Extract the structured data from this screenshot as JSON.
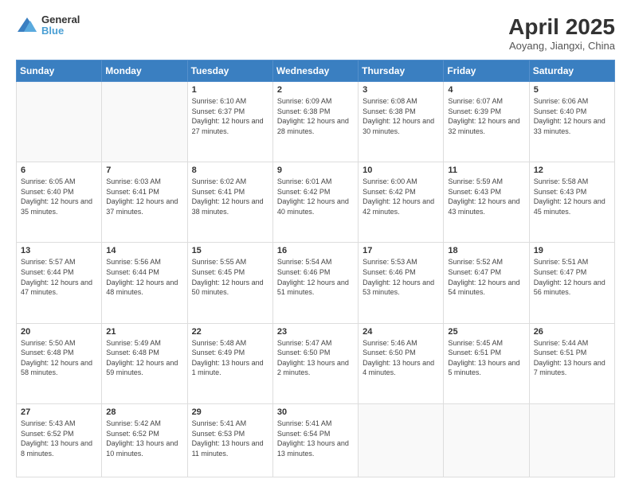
{
  "header": {
    "logo_line1": "General",
    "logo_line2": "Blue",
    "title": "April 2025",
    "subtitle": "Aoyang, Jiangxi, China"
  },
  "weekdays": [
    "Sunday",
    "Monday",
    "Tuesday",
    "Wednesday",
    "Thursday",
    "Friday",
    "Saturday"
  ],
  "weeks": [
    [
      {
        "day": "",
        "sunrise": "",
        "sunset": "",
        "daylight": ""
      },
      {
        "day": "",
        "sunrise": "",
        "sunset": "",
        "daylight": ""
      },
      {
        "day": "1",
        "sunrise": "Sunrise: 6:10 AM",
        "sunset": "Sunset: 6:37 PM",
        "daylight": "Daylight: 12 hours and 27 minutes."
      },
      {
        "day": "2",
        "sunrise": "Sunrise: 6:09 AM",
        "sunset": "Sunset: 6:38 PM",
        "daylight": "Daylight: 12 hours and 28 minutes."
      },
      {
        "day": "3",
        "sunrise": "Sunrise: 6:08 AM",
        "sunset": "Sunset: 6:38 PM",
        "daylight": "Daylight: 12 hours and 30 minutes."
      },
      {
        "day": "4",
        "sunrise": "Sunrise: 6:07 AM",
        "sunset": "Sunset: 6:39 PM",
        "daylight": "Daylight: 12 hours and 32 minutes."
      },
      {
        "day": "5",
        "sunrise": "Sunrise: 6:06 AM",
        "sunset": "Sunset: 6:40 PM",
        "daylight": "Daylight: 12 hours and 33 minutes."
      }
    ],
    [
      {
        "day": "6",
        "sunrise": "Sunrise: 6:05 AM",
        "sunset": "Sunset: 6:40 PM",
        "daylight": "Daylight: 12 hours and 35 minutes."
      },
      {
        "day": "7",
        "sunrise": "Sunrise: 6:03 AM",
        "sunset": "Sunset: 6:41 PM",
        "daylight": "Daylight: 12 hours and 37 minutes."
      },
      {
        "day": "8",
        "sunrise": "Sunrise: 6:02 AM",
        "sunset": "Sunset: 6:41 PM",
        "daylight": "Daylight: 12 hours and 38 minutes."
      },
      {
        "day": "9",
        "sunrise": "Sunrise: 6:01 AM",
        "sunset": "Sunset: 6:42 PM",
        "daylight": "Daylight: 12 hours and 40 minutes."
      },
      {
        "day": "10",
        "sunrise": "Sunrise: 6:00 AM",
        "sunset": "Sunset: 6:42 PM",
        "daylight": "Daylight: 12 hours and 42 minutes."
      },
      {
        "day": "11",
        "sunrise": "Sunrise: 5:59 AM",
        "sunset": "Sunset: 6:43 PM",
        "daylight": "Daylight: 12 hours and 43 minutes."
      },
      {
        "day": "12",
        "sunrise": "Sunrise: 5:58 AM",
        "sunset": "Sunset: 6:43 PM",
        "daylight": "Daylight: 12 hours and 45 minutes."
      }
    ],
    [
      {
        "day": "13",
        "sunrise": "Sunrise: 5:57 AM",
        "sunset": "Sunset: 6:44 PM",
        "daylight": "Daylight: 12 hours and 47 minutes."
      },
      {
        "day": "14",
        "sunrise": "Sunrise: 5:56 AM",
        "sunset": "Sunset: 6:44 PM",
        "daylight": "Daylight: 12 hours and 48 minutes."
      },
      {
        "day": "15",
        "sunrise": "Sunrise: 5:55 AM",
        "sunset": "Sunset: 6:45 PM",
        "daylight": "Daylight: 12 hours and 50 minutes."
      },
      {
        "day": "16",
        "sunrise": "Sunrise: 5:54 AM",
        "sunset": "Sunset: 6:46 PM",
        "daylight": "Daylight: 12 hours and 51 minutes."
      },
      {
        "day": "17",
        "sunrise": "Sunrise: 5:53 AM",
        "sunset": "Sunset: 6:46 PM",
        "daylight": "Daylight: 12 hours and 53 minutes."
      },
      {
        "day": "18",
        "sunrise": "Sunrise: 5:52 AM",
        "sunset": "Sunset: 6:47 PM",
        "daylight": "Daylight: 12 hours and 54 minutes."
      },
      {
        "day": "19",
        "sunrise": "Sunrise: 5:51 AM",
        "sunset": "Sunset: 6:47 PM",
        "daylight": "Daylight: 12 hours and 56 minutes."
      }
    ],
    [
      {
        "day": "20",
        "sunrise": "Sunrise: 5:50 AM",
        "sunset": "Sunset: 6:48 PM",
        "daylight": "Daylight: 12 hours and 58 minutes."
      },
      {
        "day": "21",
        "sunrise": "Sunrise: 5:49 AM",
        "sunset": "Sunset: 6:48 PM",
        "daylight": "Daylight: 12 hours and 59 minutes."
      },
      {
        "day": "22",
        "sunrise": "Sunrise: 5:48 AM",
        "sunset": "Sunset: 6:49 PM",
        "daylight": "Daylight: 13 hours and 1 minute."
      },
      {
        "day": "23",
        "sunrise": "Sunrise: 5:47 AM",
        "sunset": "Sunset: 6:50 PM",
        "daylight": "Daylight: 13 hours and 2 minutes."
      },
      {
        "day": "24",
        "sunrise": "Sunrise: 5:46 AM",
        "sunset": "Sunset: 6:50 PM",
        "daylight": "Daylight: 13 hours and 4 minutes."
      },
      {
        "day": "25",
        "sunrise": "Sunrise: 5:45 AM",
        "sunset": "Sunset: 6:51 PM",
        "daylight": "Daylight: 13 hours and 5 minutes."
      },
      {
        "day": "26",
        "sunrise": "Sunrise: 5:44 AM",
        "sunset": "Sunset: 6:51 PM",
        "daylight": "Daylight: 13 hours and 7 minutes."
      }
    ],
    [
      {
        "day": "27",
        "sunrise": "Sunrise: 5:43 AM",
        "sunset": "Sunset: 6:52 PM",
        "daylight": "Daylight: 13 hours and 8 minutes."
      },
      {
        "day": "28",
        "sunrise": "Sunrise: 5:42 AM",
        "sunset": "Sunset: 6:52 PM",
        "daylight": "Daylight: 13 hours and 10 minutes."
      },
      {
        "day": "29",
        "sunrise": "Sunrise: 5:41 AM",
        "sunset": "Sunset: 6:53 PM",
        "daylight": "Daylight: 13 hours and 11 minutes."
      },
      {
        "day": "30",
        "sunrise": "Sunrise: 5:41 AM",
        "sunset": "Sunset: 6:54 PM",
        "daylight": "Daylight: 13 hours and 13 minutes."
      },
      {
        "day": "",
        "sunrise": "",
        "sunset": "",
        "daylight": ""
      },
      {
        "day": "",
        "sunrise": "",
        "sunset": "",
        "daylight": ""
      },
      {
        "day": "",
        "sunrise": "",
        "sunset": "",
        "daylight": ""
      }
    ]
  ]
}
